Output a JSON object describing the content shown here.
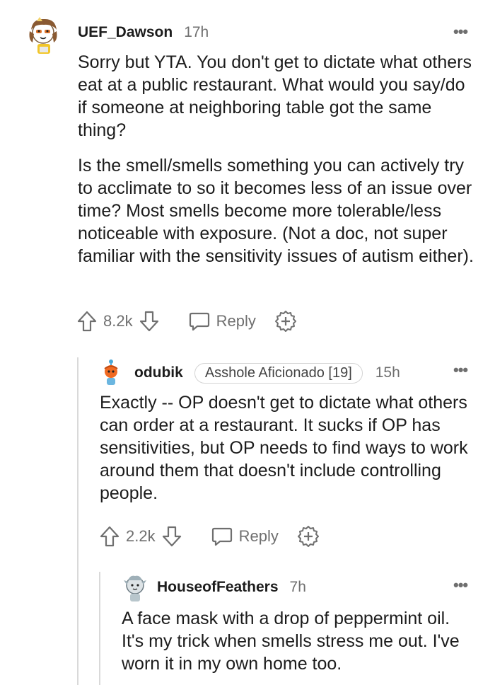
{
  "comments": [
    {
      "username": "UEF_Dawson",
      "time": "17h",
      "paragraphs": [
        "Sorry but YTA. You don't get to dictate what others eat at a public restaurant. What would you say/do if someone at neighboring table got the same thing?",
        "Is the smell/smells something you can actively try to acclimate to so it becomes less of an issue over time? Most smells become more tolerable/less noticeable with exposure. (Not a doc, not super familiar with the sensitivity issues of autism either)."
      ],
      "votes": "8.2k",
      "reply_label": "Reply"
    },
    {
      "username": "odubik",
      "flair": "Asshole Aficionado [19]",
      "time": "15h",
      "paragraphs": [
        "Exactly -- OP doesn't get to dictate what others can order at a restaurant. It sucks if OP has sensitivities, but OP needs to find ways to work around them that doesn't include controlling people."
      ],
      "votes": "2.2k",
      "reply_label": "Reply"
    },
    {
      "username": "HouseofFeathers",
      "time": "7h",
      "paragraphs": [
        "A face mask with a drop of peppermint oil. It's my trick when smells stress me out. I've worn it in my own home too."
      ]
    }
  ],
  "more_glyph": "•••",
  "icons": [
    "upvote-icon",
    "downvote-icon",
    "reply-bubble-icon",
    "award-icon",
    "more-options-icon"
  ]
}
